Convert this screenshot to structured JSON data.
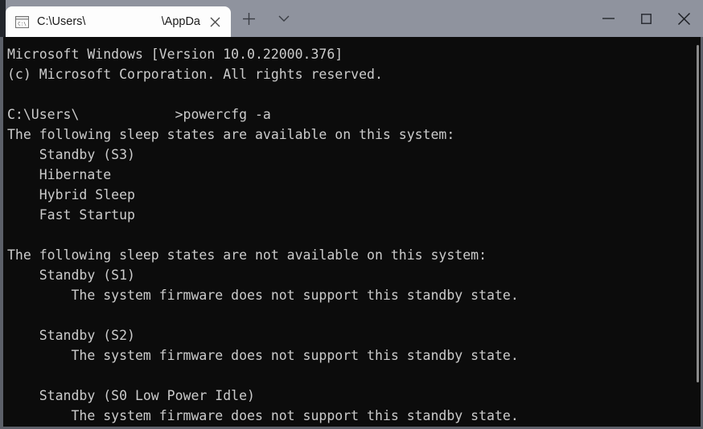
{
  "window": {
    "app": "Windows Terminal / Command Prompt",
    "titlebar_color": "#8f939e",
    "terminal_bg": "#0c0c0c",
    "terminal_fg": "#cccccc"
  },
  "tab": {
    "icon": "command-prompt-icon",
    "title_head": "C:\\Users\\",
    "title_redacted": "",
    "title_tail": "\\AppDa",
    "close_label": "✕"
  },
  "tabstrip": {
    "new_tab_label": "+",
    "dropdown_label": "∨"
  },
  "window_controls": {
    "minimize_label": "—",
    "maximize_label": "□",
    "close_label": "✕"
  },
  "console": {
    "lines": [
      "Microsoft Windows [Version 10.0.22000.376]",
      "(c) Microsoft Corporation. All rights reserved.",
      "",
      "C:\\Users\\            >powercfg -a",
      "The following sleep states are available on this system:",
      "    Standby (S3)",
      "    Hibernate",
      "    Hybrid Sleep",
      "    Fast Startup",
      "",
      "The following sleep states are not available on this system:",
      "    Standby (S1)",
      "        The system firmware does not support this standby state.",
      "",
      "    Standby (S2)",
      "        The system firmware does not support this standby state.",
      "",
      "    Standby (S0 Low Power Idle)",
      "        The system firmware does not support this standby state."
    ],
    "prompt_line_index": 3,
    "prompt_head": "C:\\Users\\",
    "prompt_redacted_width": 12,
    "prompt_command": ">powercfg -a"
  }
}
